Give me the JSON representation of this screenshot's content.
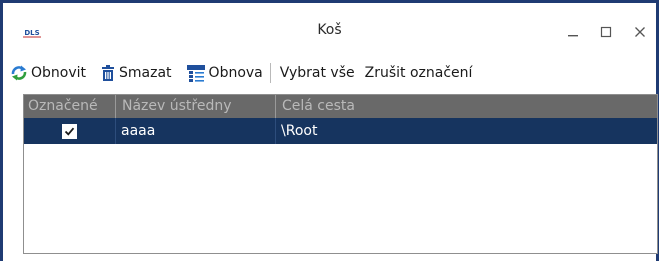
{
  "window": {
    "title": "Koš",
    "logo_icon": "dls-logo",
    "controls": {
      "minimize_icon": "minimize-icon",
      "maximize_icon": "maximize-icon",
      "close_icon": "close-icon"
    }
  },
  "toolbar": {
    "refresh_label": "Obnovit",
    "delete_label": "Smazat",
    "restore_label": "Obnova",
    "select_all_label": "Vybrat vše",
    "deselect_label": "Zrušit označení"
  },
  "grid": {
    "columns": [
      "Označené",
      "Název ústředny",
      "Celá cesta"
    ],
    "rows": [
      {
        "checked": true,
        "name": "aaaa",
        "path": "\\Root"
      }
    ]
  },
  "colors": {
    "accent": "#1f3b73",
    "header_bg": "#696969",
    "header_text": "#b9b9b9",
    "selected_row": "#16345f"
  }
}
